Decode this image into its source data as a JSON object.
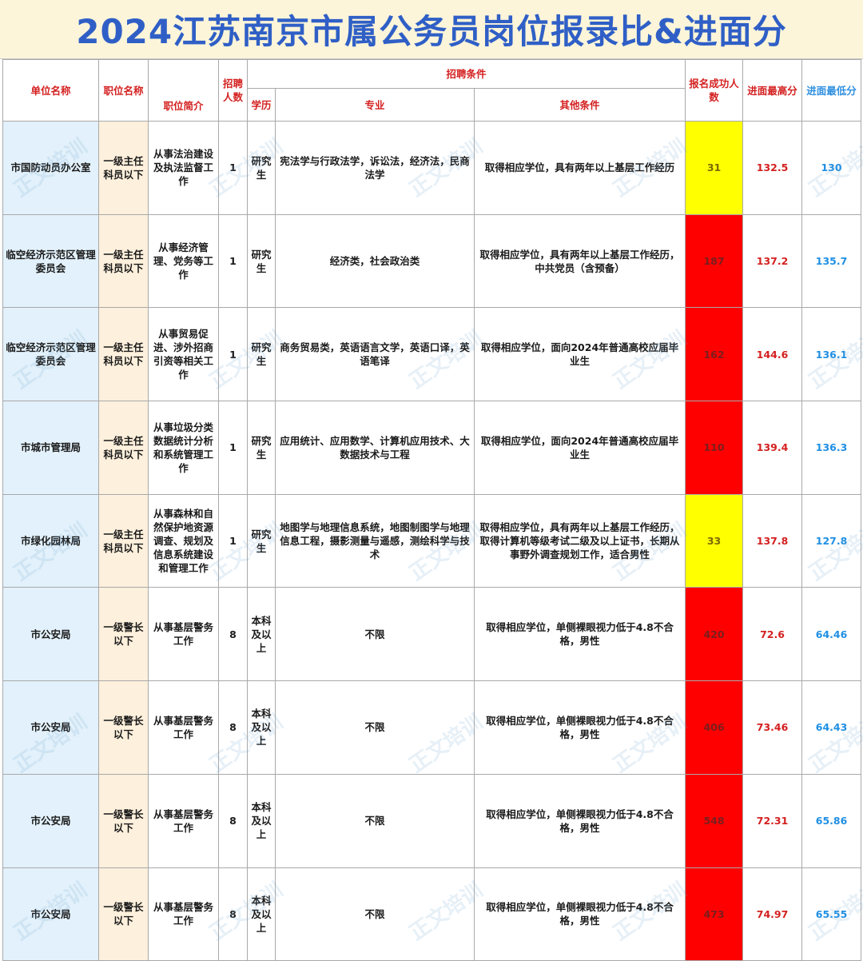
{
  "title": "2024江苏南京市属公务员岗位报录比&进面分",
  "watermark": "正文培训",
  "colors": {
    "title_text": "#2f5fc6",
    "title_bg": "#fdf5d9",
    "header_red": "#d42020",
    "header_blue": "#2e8fe0",
    "count_yellow": "#ffff00",
    "count_red": "#ff0000"
  },
  "headers": {
    "unit": "单位名称",
    "position": "职位名称",
    "intro": "职位简介",
    "hires": "招聘人数",
    "conditions": "招聘条件",
    "education": "学历",
    "major": "专业",
    "other": "其他条件",
    "applicants": "报名成功人数",
    "max_score": "进面最高分",
    "min_score": "进面最低分"
  },
  "rows": [
    {
      "unit": "市国防动员办公室",
      "position": "一级主任科员以下",
      "intro": "从事法治建设及执法监督工作",
      "hires": "1",
      "education": "研究生",
      "major": "宪法学与行政法学，诉讼法，经济法，民商法学",
      "other": "取得相应学位，具有两年以上基层工作经历",
      "applicants": "31",
      "level": "yellow",
      "max": "132.5",
      "min": "130"
    },
    {
      "unit": "临空经济示范区管理委员会",
      "position": "一级主任科员以下",
      "intro": "从事经济管理、党务等工作",
      "hires": "1",
      "education": "研究生",
      "major": "经济类，社会政治类",
      "other": "取得相应学位，具有两年以上基层工作经历，中共党员（含预备）",
      "applicants": "187",
      "level": "red",
      "max": "137.2",
      "min": "135.7"
    },
    {
      "unit": "临空经济示范区管理委员会",
      "position": "一级主任科员以下",
      "intro": "从事贸易促进、涉外招商引资等相关工作",
      "hires": "1",
      "education": "研究生",
      "major": "商务贸易类，英语语言文学，英语口译，英语笔译",
      "other": "取得相应学位，面向2024年普通高校应届毕业生",
      "applicants": "162",
      "level": "red",
      "max": "144.6",
      "min": "136.1"
    },
    {
      "unit": "市城市管理局",
      "position": "一级主任科员以下",
      "intro": "从事垃圾分类数据统计分析和系统管理工作",
      "hires": "1",
      "education": "研究生",
      "major": "应用统计、应用数学、计算机应用技术、大数据技术与工程",
      "other": "取得相应学位，面向2024年普通高校应届毕业生",
      "applicants": "110",
      "level": "red",
      "max": "139.4",
      "min": "136.3"
    },
    {
      "unit": "市绿化园林局",
      "position": "一级主任科员以下",
      "intro": "从事森林和自然保护地资源调查、规划及信息系统建设和管理工作",
      "hires": "1",
      "education": "研究生",
      "major": "地图学与地理信息系统，地图制图学与地理信息工程，摄影测量与遥感，测绘科学与技术",
      "other": "取得相应学位，具有两年以上基层工作经历，取得计算机等级考试二级及以上证书，长期从事野外调查规划工作，适合男性",
      "applicants": "33",
      "level": "yellow",
      "max": "137.8",
      "min": "127.8"
    },
    {
      "unit": "市公安局",
      "position": "一级警长以下",
      "intro": "从事基层警务工作",
      "hires": "8",
      "education": "本科及以上",
      "major": "不限",
      "other": "取得相应学位，单侧裸眼视力低于4.8不合格，男性",
      "applicants": "420",
      "level": "red",
      "max": "72.6",
      "min": "64.46"
    },
    {
      "unit": "市公安局",
      "position": "一级警长以下",
      "intro": "从事基层警务工作",
      "hires": "8",
      "education": "本科及以上",
      "major": "不限",
      "other": "取得相应学位，单侧裸眼视力低于4.8不合格，男性",
      "applicants": "406",
      "level": "red",
      "max": "73.46",
      "min": "64.43"
    },
    {
      "unit": "市公安局",
      "position": "一级警长以下",
      "intro": "从事基层警务工作",
      "hires": "8",
      "education": "本科及以上",
      "major": "不限",
      "other": "取得相应学位，单侧裸眼视力低于4.8不合格，男性",
      "applicants": "548",
      "level": "red",
      "max": "72.31",
      "min": "65.86"
    },
    {
      "unit": "市公安局",
      "position": "一级警长以下",
      "intro": "从事基层警务工作",
      "hires": "8",
      "education": "本科及以上",
      "major": "不限",
      "other": "取得相应学位，单侧裸眼视力低于4.8不合格，男性",
      "applicants": "473",
      "level": "red",
      "max": "74.97",
      "min": "65.55"
    }
  ]
}
